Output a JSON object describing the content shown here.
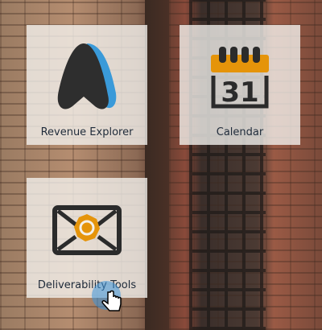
{
  "tiles": [
    {
      "label": "Revenue Explorer",
      "icon": "revenue-explorer-logo"
    },
    {
      "label": "Calendar",
      "icon": "calendar-icon",
      "day": "31"
    },
    {
      "label": "Deliverability Tools",
      "icon": "envelope-icon"
    }
  ],
  "colors": {
    "accent_orange": "#e5940a",
    "accent_blue": "#3a9ad9",
    "dark": "#2b2b2b"
  }
}
